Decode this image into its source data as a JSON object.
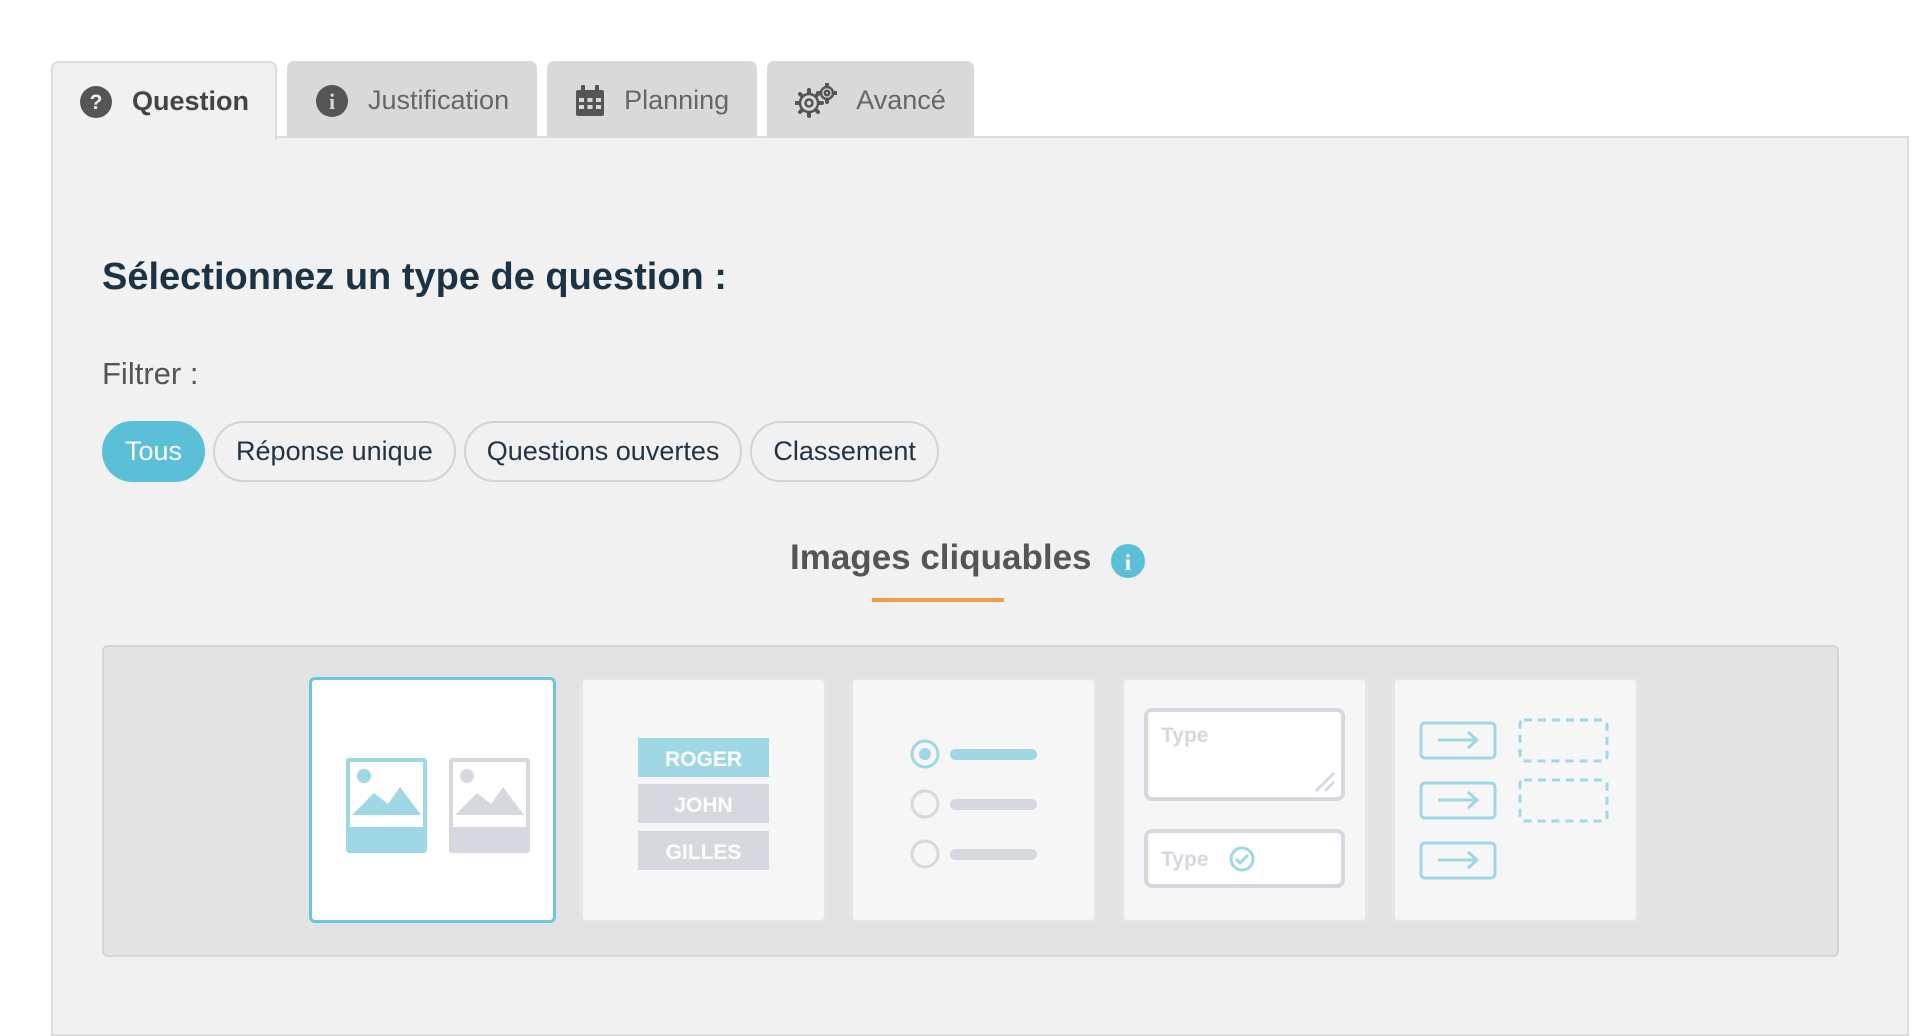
{
  "tabs": [
    {
      "label": "Question",
      "icon": "question-circle-icon",
      "active": true
    },
    {
      "label": "Justification",
      "icon": "info-circle-icon",
      "active": false
    },
    {
      "label": "Planning",
      "icon": "calendar-icon",
      "active": false
    },
    {
      "label": "Avancé",
      "icon": "gears-icon",
      "active": false
    }
  ],
  "main": {
    "heading": "Sélectionnez un type de question :",
    "filter_label": "Filtrer :",
    "filters": [
      {
        "label": "Tous",
        "active": true
      },
      {
        "label": "Réponse unique",
        "active": false
      },
      {
        "label": "Questions ouvertes",
        "active": false
      },
      {
        "label": "Classement",
        "active": false
      }
    ],
    "section_title": "Images cliquables",
    "section_info_icon": "info-circle-icon",
    "cards": [
      {
        "name": "clickable-images",
        "icon": "images-card-icon",
        "selected": true
      },
      {
        "name": "name-ranking",
        "icon": "names-list-icon",
        "labels": [
          "ROGER",
          "JOHN",
          "GILLES"
        ],
        "selected": false
      },
      {
        "name": "single-choice",
        "icon": "radio-list-icon",
        "selected": false
      },
      {
        "name": "open-text",
        "icon": "text-input-icon",
        "labels": [
          "Type",
          "Type"
        ],
        "selected": false
      },
      {
        "name": "matching",
        "icon": "matching-arrows-icon",
        "selected": false
      }
    ]
  },
  "colors": {
    "accent": "#5cbfd8",
    "underline": "#f0a04a",
    "heading": "#1b3344",
    "panel_bg": "#f1f1f1"
  }
}
